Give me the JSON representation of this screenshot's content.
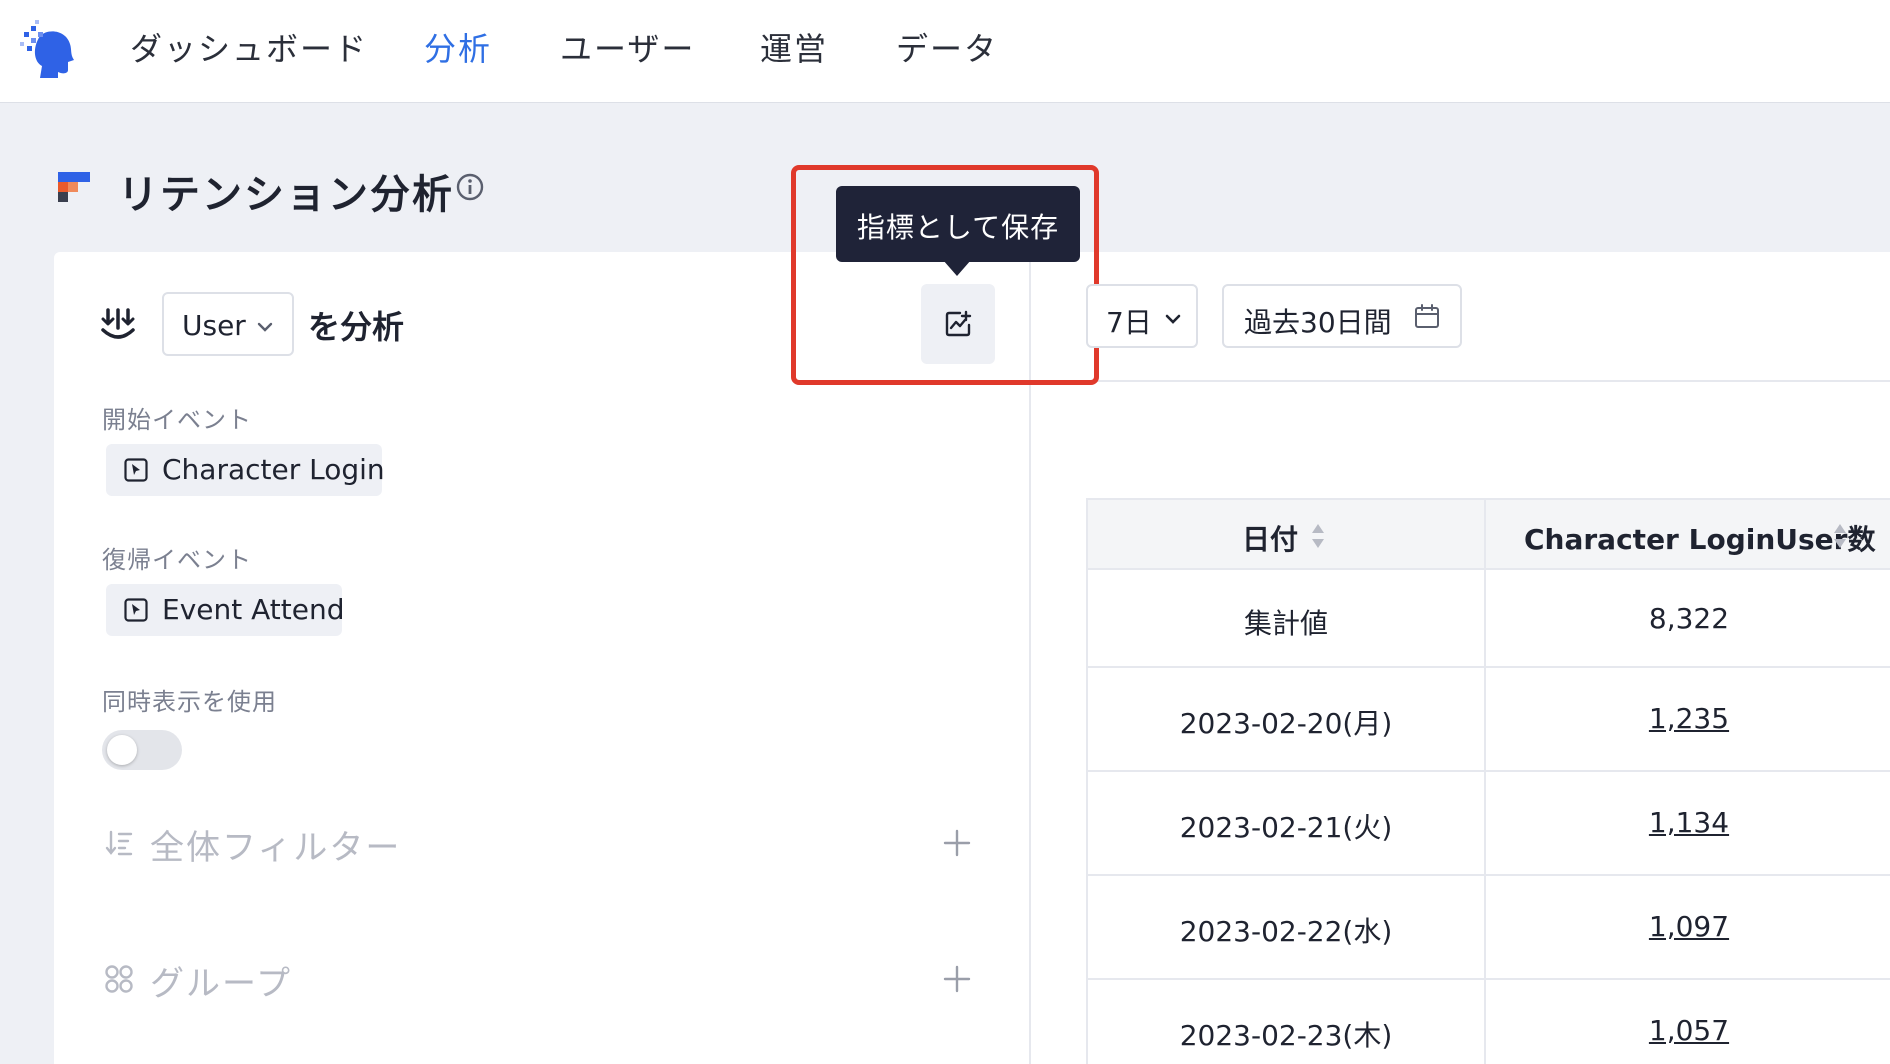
{
  "nav": {
    "items": [
      {
        "label": "ダッシュボード",
        "active": false
      },
      {
        "label": "分析",
        "active": true
      },
      {
        "label": "ユーザー",
        "active": false
      },
      {
        "label": "運営",
        "active": false
      },
      {
        "label": "データ",
        "active": false
      }
    ],
    "accent_color": "#2f6fe4"
  },
  "page": {
    "title": "リテンション分析"
  },
  "config": {
    "entity_value": "User",
    "analyze_suffix": "を分析",
    "start_event_label": "開始イベント",
    "start_event": "Character Login",
    "return_event_label": "復帰イベント",
    "return_event": "Event Attend",
    "simultaneous_label": "同時表示を使用",
    "simultaneous_on": false,
    "global_filter_label": "全体フィルター",
    "group_label": "グループ"
  },
  "save_metric": {
    "tooltip": "指標として保存",
    "highlight_color": "#e0392b"
  },
  "controls": {
    "interval": "7日",
    "date_range": "過去30日間"
  },
  "table": {
    "headers": [
      "日付",
      "Character LoginUser数"
    ],
    "rows": [
      {
        "date": "集計値",
        "value": "8,322",
        "link": false
      },
      {
        "date": "2023-02-20(月)",
        "value": "1,235",
        "link": true
      },
      {
        "date": "2023-02-21(火)",
        "value": "1,134",
        "link": true
      },
      {
        "date": "2023-02-22(水)",
        "value": "1,097",
        "link": true
      },
      {
        "date": "2023-02-23(木)",
        "value": "1,057",
        "link": true
      }
    ]
  }
}
